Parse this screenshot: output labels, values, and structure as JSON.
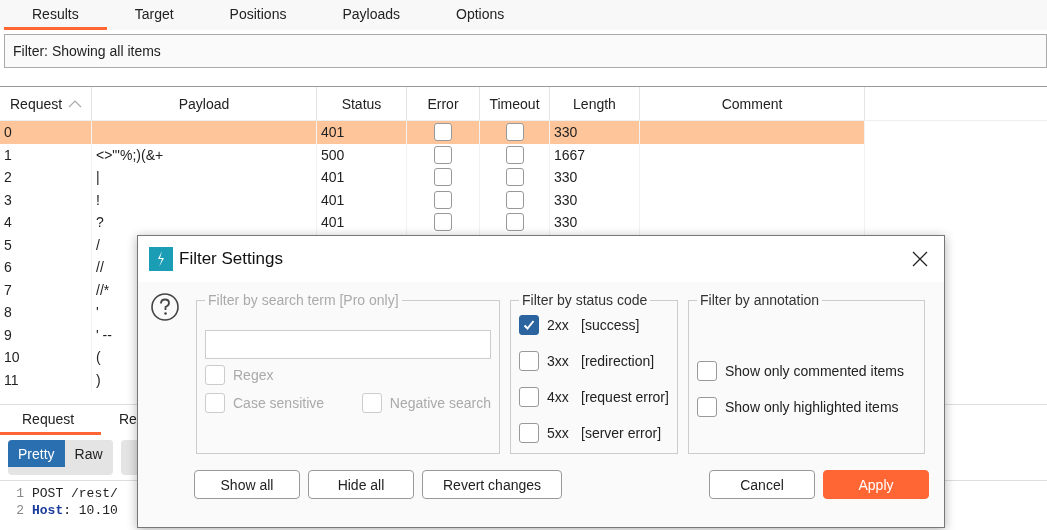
{
  "tabs": [
    {
      "label": "Results",
      "selected": true
    },
    {
      "label": "Target",
      "selected": false
    },
    {
      "label": "Positions",
      "selected": false
    },
    {
      "label": "Payloads",
      "selected": false
    },
    {
      "label": "Options",
      "selected": false
    }
  ],
  "filter_bar": {
    "text": "Filter: Showing all items"
  },
  "table": {
    "columns": [
      {
        "label": "Request",
        "sorted": true
      },
      {
        "label": "Payload",
        "sorted": false
      },
      {
        "label": "Status",
        "sorted": false
      },
      {
        "label": "Error",
        "sorted": false
      },
      {
        "label": "Timeout",
        "sorted": false
      },
      {
        "label": "Length",
        "sorted": false
      },
      {
        "label": "Comment",
        "sorted": false
      }
    ],
    "rows": [
      {
        "request": "0",
        "payload": "",
        "status": "401",
        "error": false,
        "timeout": false,
        "length": "330",
        "selected": true
      },
      {
        "request": "1",
        "payload": "<>\"'%;)(&+",
        "status": "500",
        "error": false,
        "timeout": false,
        "length": "1667",
        "selected": false
      },
      {
        "request": "2",
        "payload": "|",
        "status": "401",
        "error": false,
        "timeout": false,
        "length": "330",
        "selected": false
      },
      {
        "request": "3",
        "payload": "!",
        "status": "401",
        "error": false,
        "timeout": false,
        "length": "330",
        "selected": false
      },
      {
        "request": "4",
        "payload": "?",
        "status": "401",
        "error": false,
        "timeout": false,
        "length": "330",
        "selected": false
      },
      {
        "request": "5",
        "payload": "/",
        "selected": false
      },
      {
        "request": "6",
        "payload": "//",
        "selected": false
      },
      {
        "request": "7",
        "payload": "//*",
        "selected": false
      },
      {
        "request": "8",
        "payload": "'",
        "selected": false
      },
      {
        "request": "9",
        "payload": "' --",
        "selected": false
      },
      {
        "request": "10",
        "payload": "(",
        "selected": false
      },
      {
        "request": "11",
        "payload": ")",
        "selected": false
      }
    ]
  },
  "bottom_tabs": [
    {
      "label": "Request",
      "selected": true
    },
    {
      "label": "Re",
      "selected": false
    }
  ],
  "view_buttons": [
    {
      "label": "Pretty",
      "selected": true
    },
    {
      "label": "Raw",
      "selected": false
    }
  ],
  "code_lines": [
    {
      "number": "1",
      "text": "POST /rest/"
    },
    {
      "number": "2",
      "key": "Host",
      "text": ": 10.10"
    }
  ],
  "dialog": {
    "title": "Filter Settings",
    "search_group": {
      "title": "Filter by search term [Pro only]",
      "disabled": true,
      "options": [
        {
          "label": "Regex",
          "checked": false
        },
        {
          "label": "Case sensitive",
          "checked": false
        },
        {
          "label": "Negative search",
          "checked": false
        }
      ]
    },
    "status_group": {
      "title": "Filter by status code",
      "items": [
        {
          "code": "2xx",
          "label": "[success]",
          "checked": true
        },
        {
          "code": "3xx",
          "label": "[redirection]",
          "checked": false
        },
        {
          "code": "4xx",
          "label": "[request error]",
          "checked": false
        },
        {
          "code": "5xx",
          "label": "[server error]",
          "checked": false
        }
      ]
    },
    "annotation_group": {
      "title": "Filter by annotation",
      "items": [
        {
          "label": "Show only commented items",
          "checked": false
        },
        {
          "label": "Show only highlighted items",
          "checked": false
        }
      ]
    },
    "buttons": [
      {
        "label": "Show all",
        "kind": "normal"
      },
      {
        "label": "Hide all",
        "kind": "normal"
      },
      {
        "label": "Revert changes",
        "kind": "normal"
      },
      {
        "label": "Cancel",
        "kind": "normal"
      },
      {
        "label": "Apply",
        "kind": "primary"
      }
    ]
  }
}
